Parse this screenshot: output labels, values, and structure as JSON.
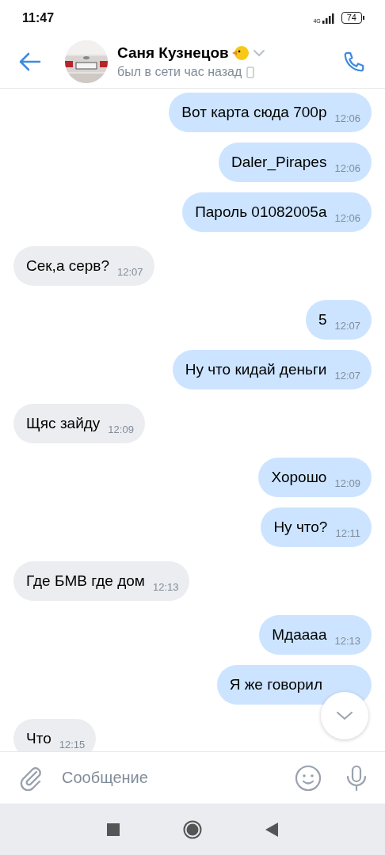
{
  "status_bar": {
    "time": "11:47",
    "network": "4G",
    "battery": "74"
  },
  "header": {
    "name": "Саня Кузнецов",
    "status": "был в сети час назад"
  },
  "messages": [
    {
      "outgoing": true,
      "text": "Вот карта сюда 700р",
      "time": "12:06"
    },
    {
      "outgoing": true,
      "text": "Daler_Pirapes",
      "time": "12:06"
    },
    {
      "outgoing": true,
      "text": "Пароль 01082005а",
      "time": "12:06"
    },
    {
      "outgoing": false,
      "text": "Сек,а серв?",
      "time": "12:07"
    },
    {
      "outgoing": true,
      "text": "5",
      "time": "12:07"
    },
    {
      "outgoing": true,
      "text": "Ну что кидай деньги",
      "time": "12:07"
    },
    {
      "outgoing": false,
      "text": "Щяс зайду",
      "time": "12:09"
    },
    {
      "outgoing": true,
      "text": "Хорошо",
      "time": "12:09"
    },
    {
      "outgoing": true,
      "text": "Ну что?",
      "time": "12:11"
    },
    {
      "outgoing": false,
      "text": "Где БМВ где дом",
      "time": "12:13"
    },
    {
      "outgoing": true,
      "text": "Мдаааа",
      "time": "12:13"
    },
    {
      "outgoing": true,
      "text": "Я же говорил"
    },
    {
      "outgoing": false,
      "text": "Что",
      "time": "12:15"
    }
  ],
  "composer": {
    "placeholder": "Сообщение"
  }
}
